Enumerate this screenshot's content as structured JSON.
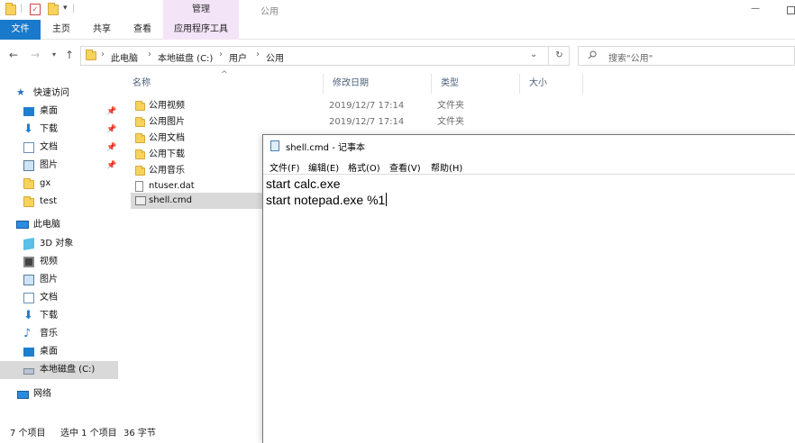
{
  "explorer": {
    "title": "公用",
    "ribbon": {
      "manage_label": "管理",
      "tabs": {
        "file": "文件",
        "home": "主页",
        "share": "共享",
        "view": "查看",
        "app_tools": "应用程序工具"
      }
    },
    "address": {
      "crumbs": [
        "此电脑",
        "本地磁盘 (C:)",
        "用户",
        "公用"
      ]
    },
    "search": {
      "placeholder": "搜索\"公用\""
    },
    "sidebar": {
      "quick_access": "快速访问",
      "pinned": [
        {
          "label": "桌面",
          "icon": "desktop-icon"
        },
        {
          "label": "下载",
          "icon": "download-icon"
        },
        {
          "label": "文档",
          "icon": "document-icon"
        },
        {
          "label": "图片",
          "icon": "picture-icon"
        }
      ],
      "folders": [
        "gx",
        "test"
      ],
      "this_pc": "此电脑",
      "pc_items": [
        {
          "label": "3D 对象",
          "icon": "3d-objects-icon"
        },
        {
          "label": "视频",
          "icon": "video-icon"
        },
        {
          "label": "图片",
          "icon": "picture-icon"
        },
        {
          "label": "文档",
          "icon": "document-icon"
        },
        {
          "label": "下载",
          "icon": "download-icon"
        },
        {
          "label": "音乐",
          "icon": "music-icon"
        },
        {
          "label": "桌面",
          "icon": "desktop-icon"
        },
        {
          "label": "本地磁盘 (C:)",
          "icon": "drive-icon"
        }
      ],
      "network": "网络"
    },
    "columns": {
      "name": "名称",
      "date": "修改日期",
      "type": "类型",
      "size": "大小"
    },
    "files": [
      {
        "name": "公用视频",
        "date": "2019/12/7 17:14",
        "type": "文件夹",
        "kind": "folder"
      },
      {
        "name": "公用图片",
        "date": "2019/12/7 17:14",
        "type": "文件夹",
        "kind": "folder"
      },
      {
        "name": "公用文档",
        "date": "",
        "type": "",
        "kind": "folder"
      },
      {
        "name": "公用下载",
        "date": "",
        "type": "",
        "kind": "folder"
      },
      {
        "name": "公用音乐",
        "date": "",
        "type": "",
        "kind": "folder"
      },
      {
        "name": "ntuser.dat",
        "date": "",
        "type": "",
        "kind": "file"
      },
      {
        "name": "shell.cmd",
        "date": "",
        "type": "",
        "kind": "cmd"
      }
    ],
    "status": {
      "item_count": "7 个项目",
      "selection": "选中 1 个项目",
      "size": "36 字节"
    }
  },
  "notepad": {
    "title": "shell.cmd - 记事本",
    "menus": [
      "文件(F)",
      "编辑(E)",
      "格式(O)",
      "查看(V)",
      "帮助(H)"
    ],
    "lines": [
      "start calc.exe",
      "start notepad.exe %1"
    ]
  },
  "colors": {
    "accent": "#1979ca",
    "manage_tab": "#f3e4f7",
    "folder": "#f7d35c",
    "selection": "#d9d9d9"
  }
}
